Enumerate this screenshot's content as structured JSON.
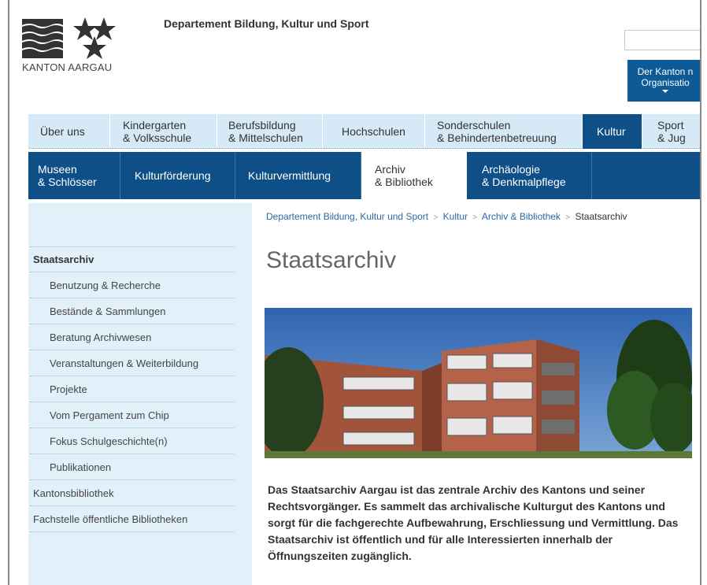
{
  "header": {
    "logo_text": "KANTON AARGAU",
    "department": "Departement Bildung, Kultur und Sport",
    "search_placeholder": "",
    "org_button_line1": "Der Kanton n",
    "org_button_line2": "Organisatio"
  },
  "main_nav": [
    {
      "line1": "Über uns",
      "line2": ""
    },
    {
      "line1": "Kindergarten",
      "line2": "& Volksschule"
    },
    {
      "line1": "Berufsbildung",
      "line2": "& Mittelschulen"
    },
    {
      "line1": "Hochschulen",
      "line2": ""
    },
    {
      "line1": "Sonderschulen",
      "line2": "& Behindertenbetreuung"
    },
    {
      "line1": "Kultur",
      "line2": ""
    },
    {
      "line1": "Sport",
      "line2": "& Jug"
    }
  ],
  "sub_nav": [
    {
      "line1": "Museen",
      "line2": "& Schlösser"
    },
    {
      "line1": "Kulturförderung",
      "line2": ""
    },
    {
      "line1": "Kulturvermittlung",
      "line2": ""
    },
    {
      "line1": "Archiv",
      "line2": "& Bibliothek"
    },
    {
      "line1": "Archäologie",
      "line2": "& Denkmalpflege"
    }
  ],
  "sidebar": {
    "items": [
      "Staatsarchiv",
      "Benutzung & Recherche",
      "Bestände & Sammlungen",
      "Beratung Archivwesen",
      "Veranstaltungen & Weiterbildung",
      "Projekte",
      "Vom Pergament zum Chip",
      "Fokus Schulgeschichte(n)",
      "Publikationen",
      "Kantonsbibliothek",
      "Fachstelle öffentliche Bibliotheken"
    ]
  },
  "breadcrumb": {
    "items": [
      "Departement Bildung, Kultur und Sport",
      "Kultur",
      "Archiv & Bibliothek"
    ],
    "separator": ">",
    "current": "Staatsarchiv"
  },
  "content": {
    "title": "Staatsarchiv",
    "intro": "Das Staatsarchiv Aargau ist das zentrale Archiv des Kantons und seiner Rechtsvorgänger. Es sammelt das archivalische Kulturgut des Kantons und sorgt für die fachgerechte Aufbewahrung, Erschliessung und Vermittlung. Das Staatsarchiv ist öffentlich und für alle Interessierten innerhalb der Öffnungszeiten zugänglich."
  },
  "colors": {
    "nav_dark": "#0e4f87",
    "nav_light": "#d5e9f6",
    "sidebar_bg": "#e2f0fa",
    "link": "#2a6aa6"
  }
}
